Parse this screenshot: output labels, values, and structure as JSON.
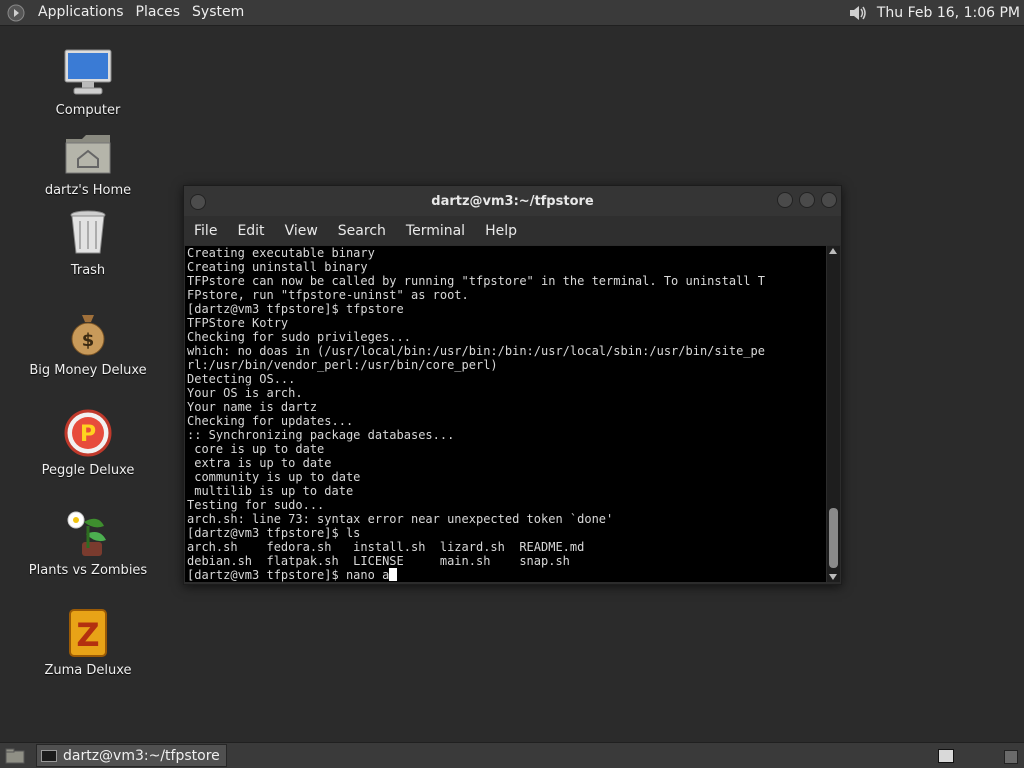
{
  "top_panel": {
    "menus": [
      "Applications",
      "Places",
      "System"
    ],
    "clock": "Thu Feb 16,  1:06 PM"
  },
  "desktop": {
    "icons": [
      {
        "label": "Computer",
        "icon": "computer-icon"
      },
      {
        "label": "dartz's Home",
        "icon": "home-folder-icon"
      },
      {
        "label": "Trash",
        "icon": "trash-icon"
      },
      {
        "label": "Big Money Deluxe",
        "icon": "money-bag-icon"
      },
      {
        "label": "Peggle Deluxe",
        "icon": "peggle-icon"
      },
      {
        "label": "Plants vs Zombies",
        "icon": "plants-vs-zombies-icon"
      },
      {
        "label": "Zuma Deluxe",
        "icon": "zuma-icon"
      }
    ]
  },
  "terminal": {
    "title": "dartz@vm3:~/tfpstore",
    "menu": [
      "File",
      "Edit",
      "View",
      "Search",
      "Terminal",
      "Help"
    ],
    "lines": [
      "Creating executable binary",
      "Creating uninstall binary",
      "TFPstore can now be called by running \"tfpstore\" in the terminal. To uninstall T",
      "FPstore, run \"tfpstore-uninst\" as root.",
      "[dartz@vm3 tfpstore]$ tfpstore",
      "TFPStore Kotry",
      "Checking for sudo privileges...",
      "which: no doas in (/usr/local/bin:/usr/bin:/bin:/usr/local/sbin:/usr/bin/site_pe",
      "rl:/usr/bin/vendor_perl:/usr/bin/core_perl)",
      "Detecting OS...",
      "Your OS is arch.",
      "Your name is dartz",
      "Checking for updates...",
      ":: Synchronizing package databases...",
      " core is up to date",
      " extra is up to date",
      " community is up to date",
      " multilib is up to date",
      "Testing for sudo...",
      "arch.sh: line 73: syntax error near unexpected token `done'",
      "[dartz@vm3 tfpstore]$ ls",
      "arch.sh    fedora.sh   install.sh  lizard.sh  README.md",
      "debian.sh  flatpak.sh  LICENSE     main.sh    snap.sh"
    ],
    "prompt_line": "[dartz@vm3 tfpstore]$ nano a"
  },
  "taskbar": {
    "window_button": "dartz@vm3:~/tfpstore"
  }
}
